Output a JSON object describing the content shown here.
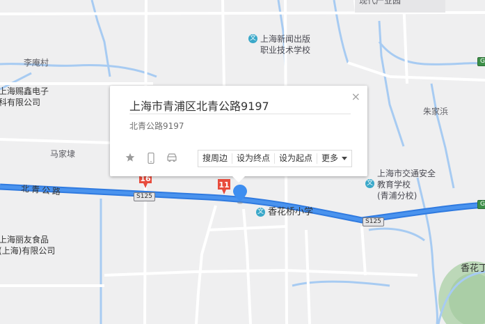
{
  "map": {
    "colors": {
      "background": "#efeff0",
      "road": "#ffffff",
      "water": "#a7cbf2",
      "highway": "#3f87e8",
      "park": "#bcd8b8"
    },
    "labels": {
      "top_right_partial": "现代产业园",
      "li_an_cun": "李庵村",
      "company1_line1": "上海赐鑫电子",
      "company1_line2": "科有限公司",
      "ma_jia_dai": "马家埭",
      "zhu_jia_bang": "朱家浜",
      "bei_qing_road": "北青公路",
      "company2_line1": "上海丽友食品",
      "company2_line2": "(上海)有限公司",
      "xiang_hua": "香花丁"
    },
    "pois": {
      "school1": {
        "line1": "上海新闻出版",
        "line2": "职业技术学校",
        "icon": "school-icon"
      },
      "school2": {
        "line1": "上海市交通安全",
        "line2": "教育学校",
        "line3": "(青浦分校)",
        "icon": "school-icon"
      },
      "school3": {
        "line1": "香花桥小学",
        "icon": "school-icon"
      }
    },
    "shields": {
      "s125_a": "S125",
      "s125_b": "S125",
      "g_a": "G",
      "g_b": "G"
    },
    "markers": {
      "m16": "16",
      "m11": "11"
    }
  },
  "popup": {
    "title": "上海市青浦区北青公路9197",
    "address": "北青公路9197",
    "close_symbol": "×",
    "icons": [
      "star-icon",
      "phone-icon",
      "car-icon"
    ],
    "actions": {
      "nearby": "搜周边",
      "set_end": "设为终点",
      "set_start": "设为起点",
      "more": "更多"
    }
  }
}
